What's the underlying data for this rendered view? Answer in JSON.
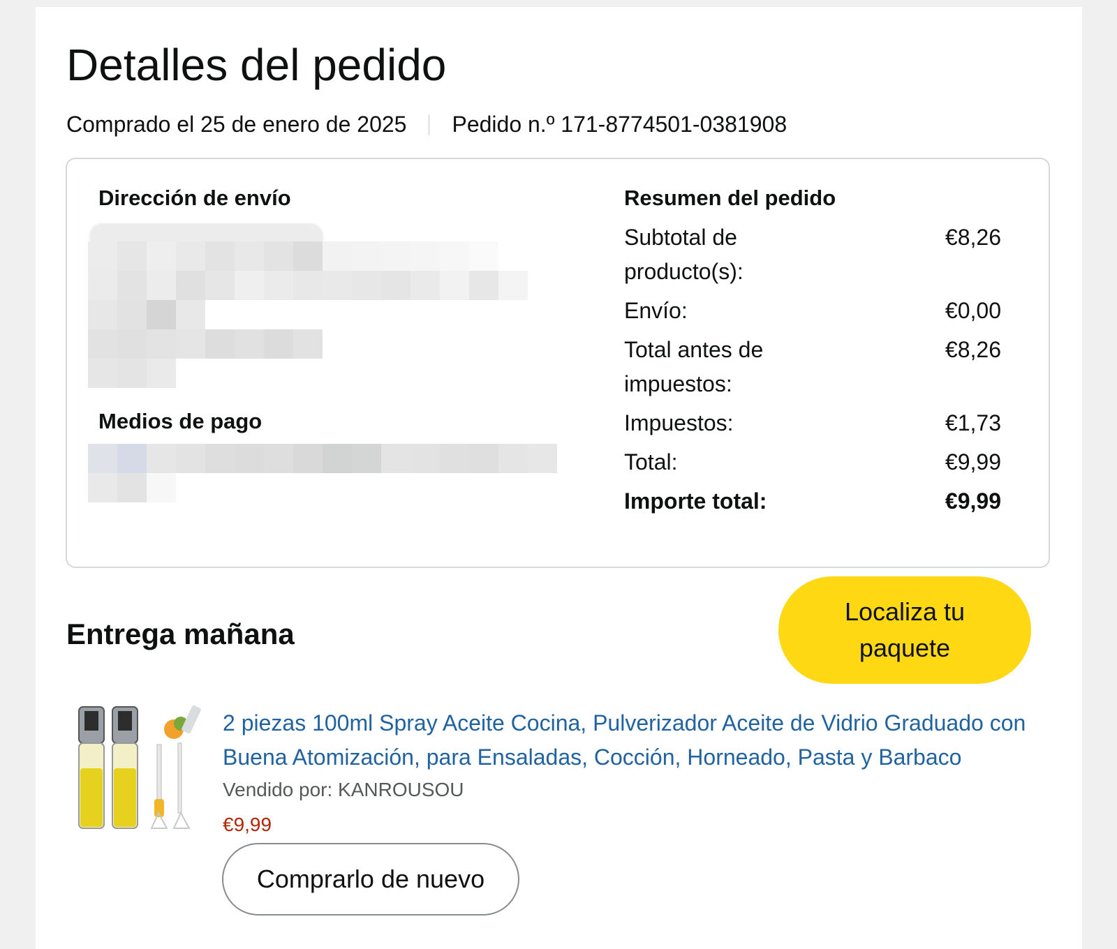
{
  "header": {
    "title": "Detalles del pedido",
    "purchase_date": "Comprado el 25 de enero de 2025",
    "order_number": "Pedido n.º 171-8774501-0381908"
  },
  "shipping": {
    "heading": "Dirección de envío"
  },
  "payment": {
    "heading": "Medios de pago"
  },
  "summary": {
    "heading": "Resumen del pedido",
    "rows": [
      {
        "label": "Subtotal de producto(s):",
        "value": "€8,26"
      },
      {
        "label": "Envío:",
        "value": "€0,00"
      },
      {
        "label": "Total antes de impuestos:",
        "value": "€8,26"
      },
      {
        "label": "Impuestos:",
        "value": "€1,73"
      },
      {
        "label": "Total:",
        "value": "€9,99"
      },
      {
        "label": "Importe total:",
        "value": "€9,99"
      }
    ]
  },
  "delivery": {
    "status": "Entrega mañana",
    "track_button": "Localiza tu paquete"
  },
  "item": {
    "title": "2 piezas 100ml Spray Aceite Cocina, Pulverizador Aceite de Vidrio Graduado con Buena Atomización, para Ensaladas, Cocción, Horneado, Pasta y Barbaco",
    "seller": "Vendido por: KANROUSOU",
    "price": "€9,99",
    "buy_again": "Comprarlo de nuevo",
    "image_icon": "oil-sprayer-product-image"
  },
  "colors": {
    "link": "#2162a1",
    "price": "#b12704",
    "primary_button": "#ffd814"
  }
}
